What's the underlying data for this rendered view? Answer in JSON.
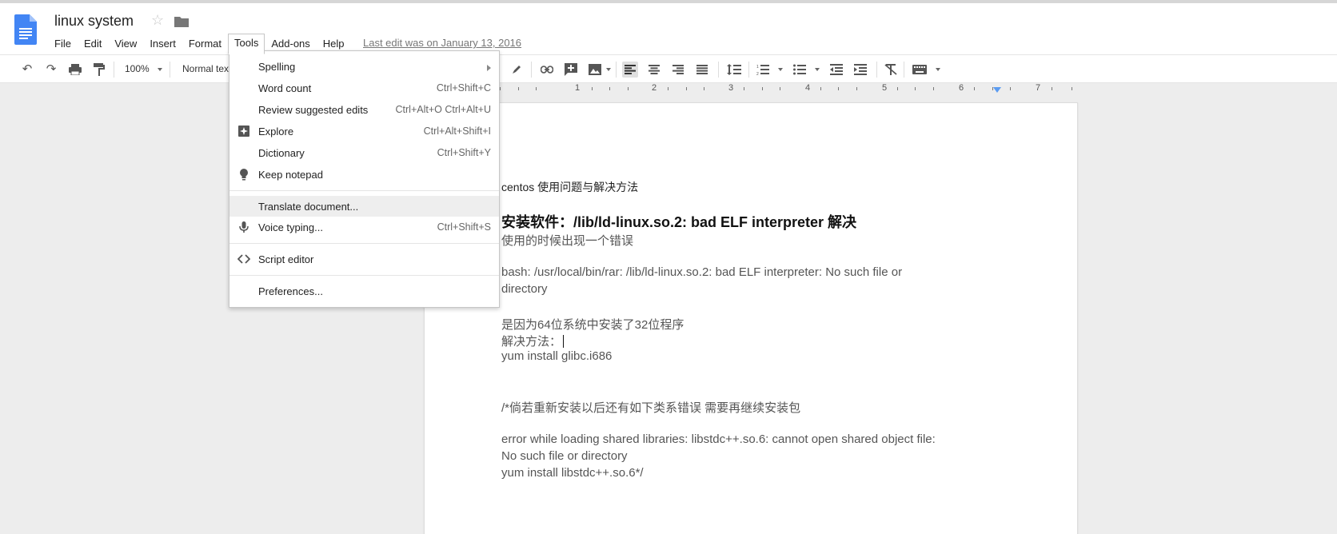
{
  "header": {
    "title": "linux system",
    "last_edit": "Last edit was on January 13, 2016"
  },
  "menubar": {
    "items": [
      "File",
      "Edit",
      "View",
      "Insert",
      "Format",
      "Tools",
      "Add-ons",
      "Help"
    ],
    "open_item": "Tools"
  },
  "toolbar": {
    "zoom": "100%",
    "style": "Normal tex"
  },
  "ruler": {
    "numbers": [
      "1",
      "2",
      "3",
      "4",
      "5",
      "6",
      "7"
    ]
  },
  "tools_menu": {
    "items": [
      {
        "label": "Spelling",
        "shortcut": "",
        "submenu": true,
        "icon": ""
      },
      {
        "label": "Word count",
        "shortcut": "Ctrl+Shift+C",
        "icon": ""
      },
      {
        "label": "Review suggested edits",
        "shortcut": "Ctrl+Alt+O Ctrl+Alt+U",
        "icon": ""
      },
      {
        "label": "Explore",
        "shortcut": "Ctrl+Alt+Shift+I",
        "icon": "explore-icon"
      },
      {
        "label": "Dictionary",
        "shortcut": "Ctrl+Shift+Y",
        "icon": ""
      },
      {
        "label": "Keep notepad",
        "shortcut": "",
        "icon": "lightbulb-icon"
      },
      {
        "label": "Translate document...",
        "shortcut": "",
        "icon": "",
        "hover": true
      },
      {
        "label": "Voice typing...",
        "shortcut": "Ctrl+Shift+S",
        "icon": "microphone-icon"
      },
      {
        "label": "Script editor",
        "shortcut": "",
        "icon": "code-icon"
      },
      {
        "label": "Preferences...",
        "shortcut": "",
        "icon": ""
      }
    ]
  },
  "document": {
    "line1": "centos 使用问题与解决方法",
    "heading": "安装软件：/lib/ld-linux.so.2: bad ELF interpreter 解决",
    "line2": "使用的时候出现一个错误",
    "line3": "bash: /usr/local/bin/rar: /lib/ld-linux.so.2: bad ELF interpreter: No such file or",
    "line4": "directory",
    "line5": "是因为64位系统中安装了32位程序",
    "line6": "解决方法：",
    "line7": "yum install glibc.i686",
    "line8": "/*倘若重新安装以后还有如下类系错误 需要再继续安装包",
    "line9": "error while loading shared libraries: libstdc++.so.6: cannot open shared object file:",
    "line10": "No such file or directory",
    "line11": "yum install libstdc++.so.6*/"
  },
  "colors": {
    "docs_blue": "#4285f4",
    "menu_hover": "#eeeeee"
  }
}
